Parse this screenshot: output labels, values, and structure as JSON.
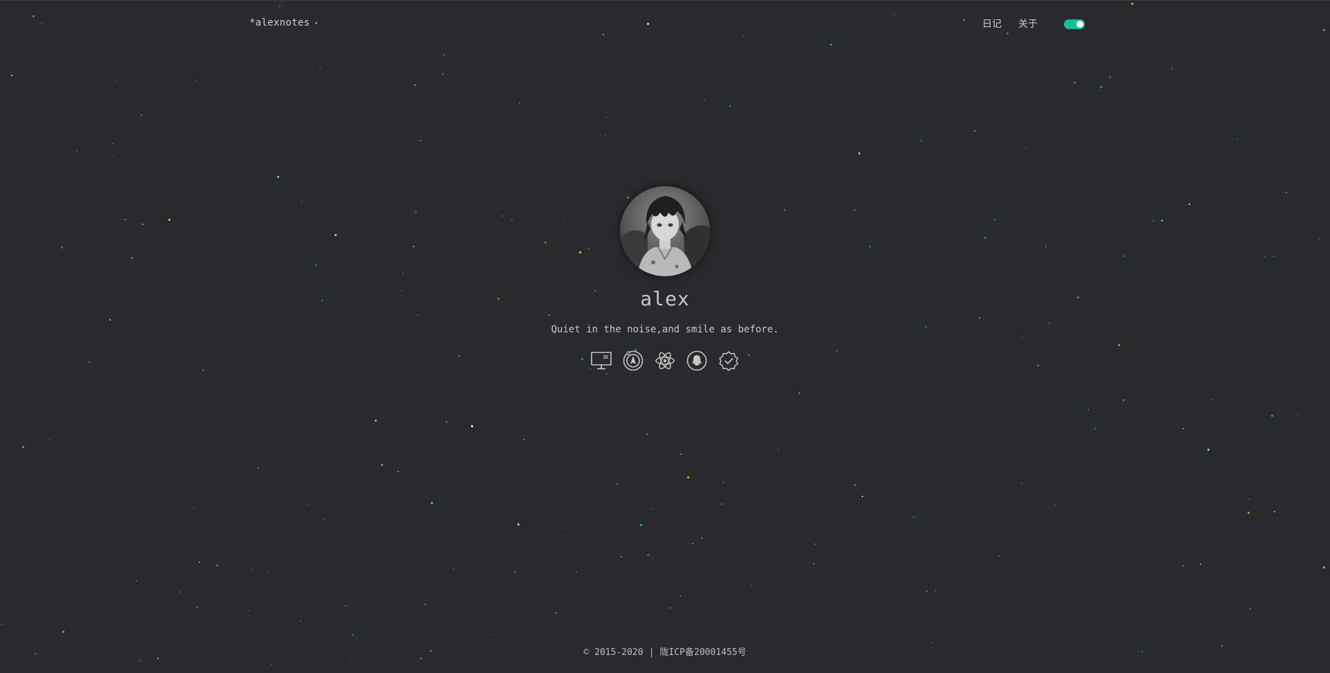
{
  "header": {
    "logo_text": "*alexnotes",
    "nav": [
      {
        "label": "日记"
      },
      {
        "label": "关于"
      }
    ],
    "theme_toggle": {
      "state": "on",
      "color": "#1abc9c"
    }
  },
  "profile": {
    "name": "alex",
    "motto": "Quiet in the noise,and smile as before.",
    "avatar": "anime-character-avatar"
  },
  "social_links": [
    {
      "icon": "desktop-icon"
    },
    {
      "icon": "compass-icon"
    },
    {
      "icon": "atom-icon"
    },
    {
      "icon": "qq-icon"
    },
    {
      "icon": "badge-check-icon"
    }
  ],
  "footer": {
    "copyright": "© 2015-2020",
    "separator": "|",
    "icp": "陇ICP备20001455号"
  },
  "colors": {
    "background": "#292a2d",
    "accent": "#1abc9c"
  }
}
